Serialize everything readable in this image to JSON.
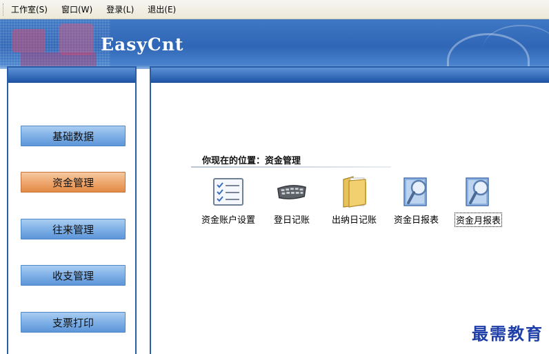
{
  "menu": {
    "items": [
      {
        "label": "工作室(S)"
      },
      {
        "label": "窗口(W)"
      },
      {
        "label": "登录(L)"
      },
      {
        "label": "退出(E)"
      }
    ]
  },
  "banner": {
    "title": "EasyCnt"
  },
  "sidebar": {
    "items": [
      {
        "label": "基础数据",
        "active": false
      },
      {
        "label": "资金管理",
        "active": true
      },
      {
        "label": "往来管理",
        "active": false
      },
      {
        "label": "收支管理",
        "active": false
      },
      {
        "label": "支票打印",
        "active": false
      }
    ]
  },
  "main": {
    "location": "你现在的位置：资金管理",
    "functions": [
      {
        "label": "资金账户设置",
        "icon": "checklist-icon"
      },
      {
        "label": "登日记账",
        "icon": "keyboard-icon"
      },
      {
        "label": "出纳日记账",
        "icon": "folder-icon"
      },
      {
        "label": "资金日报表",
        "icon": "magnifier-report-icon"
      },
      {
        "label": "资金月报表",
        "icon": "magnifier-report-icon"
      }
    ]
  },
  "watermark": "最需教育",
  "colors": {
    "accent": "#2a5da8",
    "active_button": "#eea870",
    "nav_button": "#7fb0e6"
  }
}
